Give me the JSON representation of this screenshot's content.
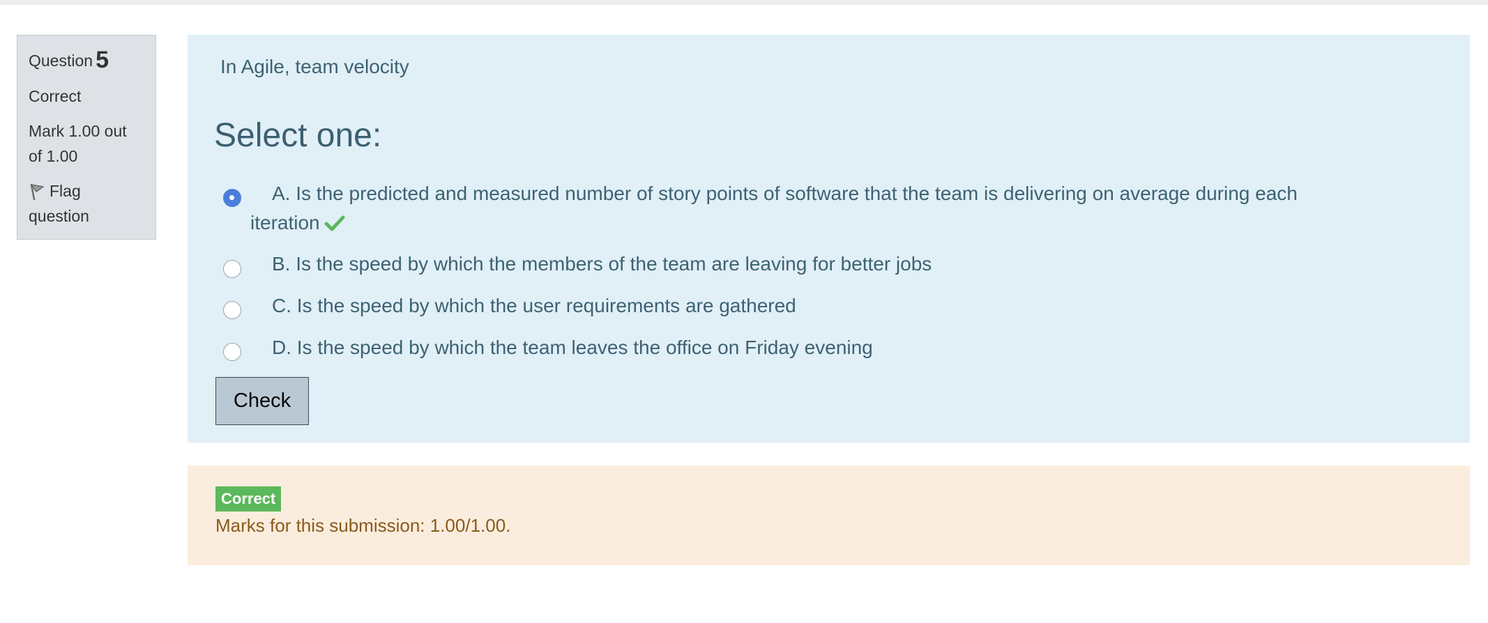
{
  "info": {
    "question_label": "Question",
    "question_number": "5",
    "state": "Correct",
    "grade_line1": "Mark 1.00 out",
    "grade_line2": "of 1.00",
    "flag_line1": "Flag",
    "flag_line2": "question",
    "flag_icon": "flag-icon"
  },
  "question": {
    "text": "In Agile, team velocity",
    "prompt": "Select one:",
    "answers": [
      {
        "letter": "A.",
        "text": "Is the predicted and measured number of story points of software that the team is delivering on average during each",
        "continuation": "iteration",
        "selected": true,
        "correct_icon": "check-icon"
      },
      {
        "letter": "B.",
        "text": "Is the speed by which the members of the team are leaving for better jobs",
        "selected": false
      },
      {
        "letter": "C.",
        "text": "Is the speed by which the user requirements are gathered",
        "selected": false
      },
      {
        "letter": "D.",
        "text": "Is the speed by which the team leaves the office on Friday evening",
        "selected": false
      }
    ],
    "check_label": "Check"
  },
  "feedback": {
    "badge": "Correct",
    "marks": "Marks for this submission: 1.00/1.00."
  },
  "colors": {
    "question_bg": "#e1eff7",
    "feedback_bg": "#fbeddd",
    "correct_green": "#5cb85c",
    "radio_selected": "#4a7fd9"
  }
}
